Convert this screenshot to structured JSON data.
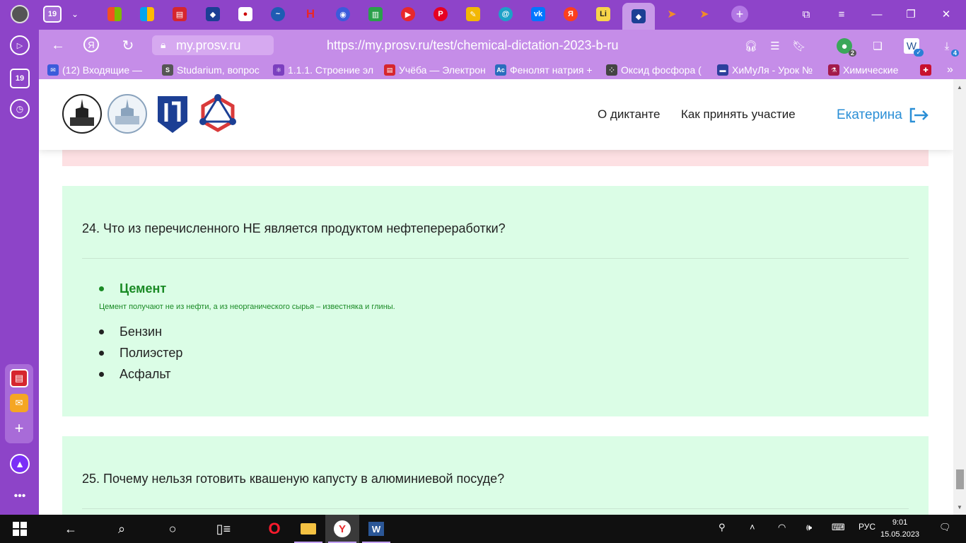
{
  "browser": {
    "sidebar_tab_count": "19",
    "address": {
      "domain": "my.prosv.ru",
      "url": "https://my.prosv.ru/test/chemical-dictation-2023-b-ru"
    },
    "badges": {
      "extensions": "2",
      "downloads": "4"
    },
    "bookmarks": [
      {
        "label": "(12) Входящие — ",
        "icon": "mail-icon",
        "color": "#3b5bdb"
      },
      {
        "label": "Studarium, вопрос",
        "icon": "studarium-icon",
        "color": "#555555"
      },
      {
        "label": "1.1.1. Строение эл",
        "icon": "atom-icon",
        "color": "#7b3fbf"
      },
      {
        "label": "Учёба — Электрон",
        "icon": "document-icon",
        "color": "#d6262e"
      },
      {
        "label": "Фенолят натрия +",
        "icon": "chem-ac-icon",
        "color": "#2a6dbd"
      },
      {
        "label": "Оксид фосфора (",
        "icon": "molecule-icon",
        "color": "#444444"
      },
      {
        "label": "ХиМуЛя - Урок №",
        "icon": "site-icon",
        "color": "#2d3f9c"
      },
      {
        "label": "Химические",
        "icon": "flask-icon",
        "color": "#a31a4b"
      },
      {
        "label": "",
        "icon": "uk-flag-icon",
        "color": "#c8102e"
      }
    ]
  },
  "site": {
    "nav": {
      "about": "О диктанте",
      "how": "Как принять участие"
    },
    "user_name": "Екатерина"
  },
  "questions": [
    {
      "title": "24. Что из перечисленного НЕ является продуктом нефтепереработки?",
      "correct": "Цемент",
      "explanation": "Цемент получают не из нефти, а из неорганического сырья – известняка и глины.",
      "options": [
        "Бензин",
        "Полиэстер",
        "Асфальт"
      ]
    },
    {
      "title": "25. Почему нельзя готовить квашеную капусту в алюминиевой посуде?"
    }
  ],
  "taskbar": {
    "language": "РУС",
    "time": "9:01",
    "date": "15.05.2023"
  }
}
